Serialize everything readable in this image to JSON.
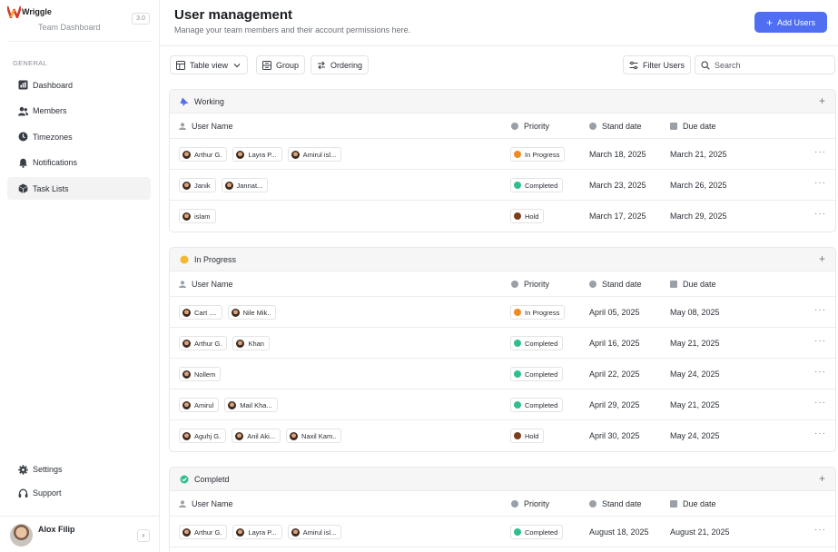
{
  "colors": {
    "accent": "#4f6ef2",
    "in_progress": "#f08a24",
    "completed": "#2fbf8f",
    "hold": "#7a3d1e",
    "working_icon": "#4f6ef2",
    "inprogress_group_icon": "#f5b82e",
    "completed_group_icon": "#2fbf8f"
  },
  "brand": {
    "name": "Wriggle",
    "subtitle": "Team Dashboard",
    "version": "3.0"
  },
  "sidebar": {
    "section_label": "GENERAL",
    "items": [
      {
        "label": "Dashboard",
        "icon": "chart-icon"
      },
      {
        "label": "Members",
        "icon": "members-icon"
      },
      {
        "label": "Timezones",
        "icon": "clock-icon"
      },
      {
        "label": "Notifications",
        "icon": "bell-icon"
      },
      {
        "label": "Task Lists",
        "icon": "cube-icon",
        "active": true
      }
    ],
    "bottom_items": [
      {
        "label": "Settings",
        "icon": "gear-icon"
      },
      {
        "label": "Support",
        "icon": "headphones-icon"
      }
    ],
    "profile": {
      "name": "Alox Filip",
      "collapse_glyph": "›"
    }
  },
  "header": {
    "title": "User management",
    "subtitle": "Manage your team members and their account permissions here.",
    "add_button": "Add Users"
  },
  "toolbar": {
    "table_view": "Table view",
    "group": "Group",
    "ordering": "Ordering",
    "filter": "Filter Users",
    "search_placeholder": "Search"
  },
  "columns": {
    "user": "User Name",
    "priority": "Priority",
    "start": "Stand date",
    "due": "Due date"
  },
  "groups": [
    {
      "title": "Working",
      "rows": [
        {
          "users": [
            "Arthur G.",
            "Layra P...",
            "Amirul isl..."
          ],
          "status": "In Progress",
          "start": "March 18, 2025",
          "due": "March 21, 2025"
        },
        {
          "users": [
            "Janik",
            "Jannat..."
          ],
          "status": "Completed",
          "start": "March 23, 2025",
          "due": "March 26, 2025"
        },
        {
          "users": [
            "islam"
          ],
          "status": "Hold",
          "start": "March 17, 2025",
          "due": "March 29, 2025"
        }
      ]
    },
    {
      "title": "In Progress",
      "rows": [
        {
          "users": [
            "Cart ....",
            "Nile Mik.."
          ],
          "status": "In Progress",
          "start": "April 05, 2025",
          "due": "May 08, 2025"
        },
        {
          "users": [
            "Arthur G.",
            "Khan"
          ],
          "status": "Completed",
          "start": "April 16, 2025",
          "due": "May 21, 2025"
        },
        {
          "users": [
            "Nollem"
          ],
          "status": "Completed",
          "start": "April 22, 2025",
          "due": "May 24, 2025"
        },
        {
          "users": [
            "Amirul",
            "Mail Kha..."
          ],
          "status": "Completed",
          "start": "April 29, 2025",
          "due": "May 21, 2025"
        },
        {
          "users": [
            "Aguhj G.",
            "Anil Aki...",
            "Naxil Kam.."
          ],
          "status": "Hold",
          "start": "April 30, 2025",
          "due": "May 24, 2025"
        }
      ]
    },
    {
      "title": "Completd",
      "rows": [
        {
          "users": [
            "Arthur G.",
            "Layra P...",
            "Amirul isl..."
          ],
          "status": "Completed",
          "start": "August 18, 2025",
          "due": "August 21, 2025"
        }
      ]
    }
  ]
}
